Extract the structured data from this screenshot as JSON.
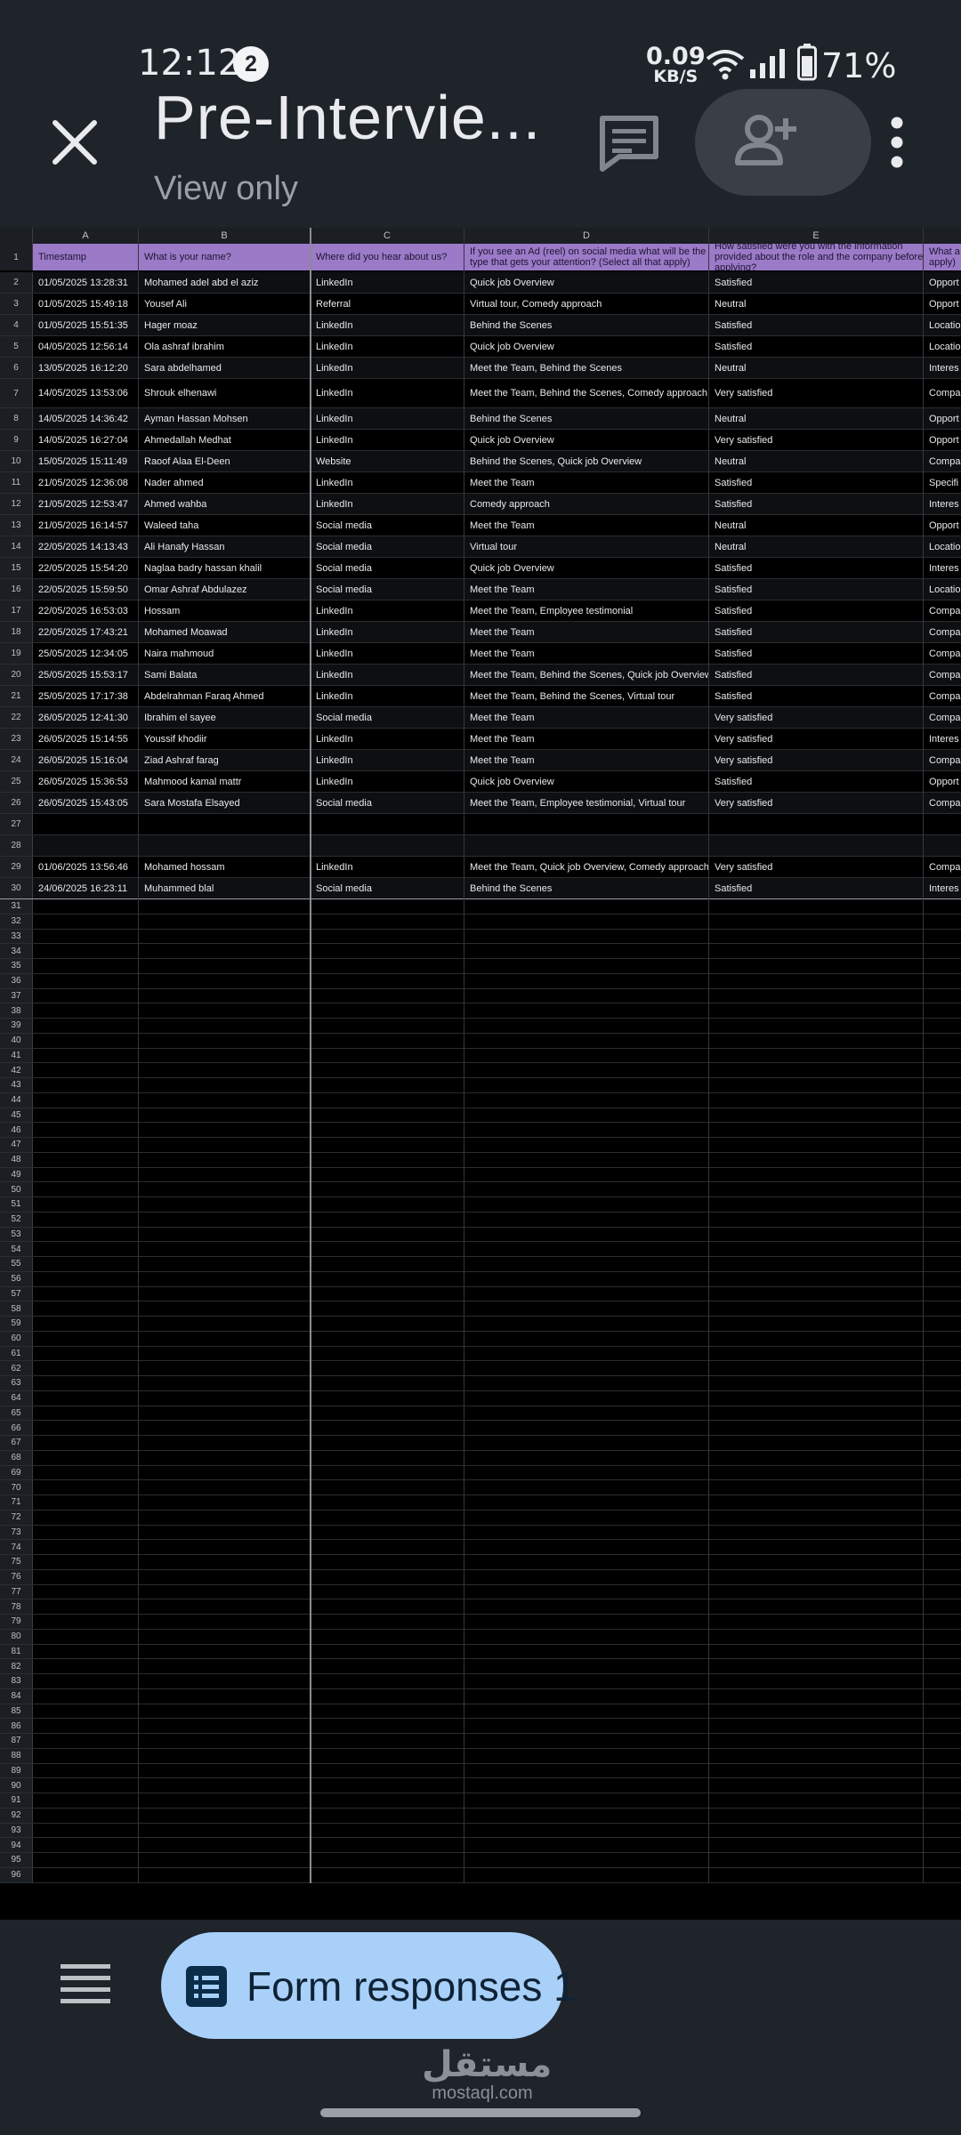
{
  "status_bar": {
    "time": "12:12",
    "notification_count": "2",
    "network_speed": "0.09",
    "network_unit": "KB/S",
    "battery": "71%"
  },
  "header": {
    "title": "Pre-Intervie...",
    "subtitle": "View only"
  },
  "sheet": {
    "column_letters": [
      "A",
      "B",
      "C",
      "D",
      "E",
      ""
    ],
    "headers": [
      "Timestamp",
      "What is your name?",
      "Where did you hear about us?",
      "If you see an Ad (reel) on social media what will be the type that gets your attention? (Select all that apply)",
      "How satisfied were you with the information provided about the role and the company before applying?",
      "What a apply)"
    ],
    "rows": [
      {
        "n": "2",
        "cells": [
          "01/05/2025 13:28:31",
          "Mohamed adel abd el aziz",
          "LinkedIn",
          "Quick job Overview",
          "Satisfied",
          "Opport"
        ]
      },
      {
        "n": "3",
        "cells": [
          "01/05/2025 15:49:18",
          "Yousef Ali",
          "Referral",
          "Virtual tour, Comedy approach",
          "Neutral",
          "Opport"
        ]
      },
      {
        "n": "4",
        "cells": [
          "01/05/2025 15:51:35",
          "Hager moaz",
          "LinkedIn",
          "Behind the Scenes",
          "Satisfied",
          "Locatio"
        ]
      },
      {
        "n": "5",
        "cells": [
          "04/05/2025 12:56:14",
          "Ola ashraf ibrahim",
          "LinkedIn",
          "Quick job Overview",
          "Satisfied",
          "Locatio"
        ]
      },
      {
        "n": "6",
        "cells": [
          "13/05/2025 16:12:20",
          "Sara abdelhamed",
          "LinkedIn",
          "Meet the Team, Behind the Scenes",
          "Neutral",
          "Interes"
        ]
      },
      {
        "n": "7",
        "cells": [
          "14/05/2025 13:53:06",
          "Shrouk elhenawi",
          "LinkedIn",
          "Meet the Team, Behind the Scenes, Comedy approach",
          "Very satisfied",
          "Compa growth Interes"
        ]
      },
      {
        "n": "8",
        "cells": [
          "14/05/2025 14:36:42",
          "Ayman Hassan Mohsen",
          "LinkedIn",
          "Behind the Scenes",
          "Neutral",
          "Opport"
        ]
      },
      {
        "n": "9",
        "cells": [
          "14/05/2025 16:27:04",
          "Ahmedallah Medhat",
          "LinkedIn",
          "Quick job Overview",
          "Very satisfied",
          "Opport"
        ]
      },
      {
        "n": "10",
        "cells": [
          "15/05/2025 15:11:49",
          "Raoof Alaa El-Deen",
          "Website",
          "Behind the Scenes, Quick job Overview",
          "Neutral",
          "Compa"
        ]
      },
      {
        "n": "11",
        "cells": [
          "21/05/2025 12:36:08",
          "Nader ahmed",
          "LinkedIn",
          "Meet the Team",
          "Satisfied",
          "Specifi"
        ]
      },
      {
        "n": "12",
        "cells": [
          "21/05/2025 12:53:47",
          "Ahmed wahba",
          "LinkedIn",
          "Comedy approach",
          "Satisfied",
          "Interes"
        ]
      },
      {
        "n": "13",
        "cells": [
          "21/05/2025 16:14:57",
          "Waleed taha",
          "Social media",
          "Meet the Team",
          "Neutral",
          "Opport"
        ]
      },
      {
        "n": "14",
        "cells": [
          "22/05/2025 14:13:43",
          "Ali Hanafy Hassan",
          "Social media",
          "Virtual tour",
          "Neutral",
          "Locatio"
        ]
      },
      {
        "n": "15",
        "cells": [
          "22/05/2025 15:54:20",
          "Naglaa badry hassan khalil",
          "Social media",
          "Quick job Overview",
          "Satisfied",
          "Interes"
        ]
      },
      {
        "n": "16",
        "cells": [
          "22/05/2025 15:59:50",
          "Omar Ashraf Abdulazez",
          "Social media",
          "Meet the Team",
          "Satisfied",
          "Locatio"
        ]
      },
      {
        "n": "17",
        "cells": [
          "22/05/2025 16:53:03",
          "Hossam",
          "LinkedIn",
          "Meet the Team, Employee testimonial",
          "Satisfied",
          "Compa"
        ]
      },
      {
        "n": "18",
        "cells": [
          "22/05/2025 17:43:21",
          "Mohamed Moawad",
          "LinkedIn",
          "Meet the Team",
          "Satisfied",
          "Compa"
        ]
      },
      {
        "n": "19",
        "cells": [
          "25/05/2025 12:34:05",
          "Naira mahmoud",
          "LinkedIn",
          "Meet the Team",
          "Satisfied",
          "Compa"
        ]
      },
      {
        "n": "20",
        "cells": [
          "25/05/2025 15:53:17",
          "Sami Balata",
          "LinkedIn",
          "Meet the Team, Behind the Scenes, Quick job Overview",
          "Satisfied",
          "Compa"
        ]
      },
      {
        "n": "21",
        "cells": [
          "25/05/2025 17:17:38",
          "Abdelrahman Faraq Ahmed",
          "LinkedIn",
          "Meet the Team, Behind the Scenes, Virtual tour",
          "Satisfied",
          "Compa"
        ]
      },
      {
        "n": "22",
        "cells": [
          "26/05/2025 12:41:30",
          "Ibrahim el sayee",
          "Social media",
          "Meet the Team",
          "Very satisfied",
          "Compa"
        ]
      },
      {
        "n": "23",
        "cells": [
          "26/05/2025 15:14:55",
          "Youssif khodiir",
          "LinkedIn",
          "Meet the Team",
          "Very satisfied",
          "Interes"
        ]
      },
      {
        "n": "24",
        "cells": [
          "26/05/2025 15:16:04",
          "Ziad Ashraf farag",
          "LinkedIn",
          "Meet the Team",
          "Very satisfied",
          "Compa"
        ]
      },
      {
        "n": "25",
        "cells": [
          "26/05/2025 15:36:53",
          "Mahmood kamal mattr",
          "LinkedIn",
          "Quick job Overview",
          "Satisfied",
          "Opport"
        ]
      },
      {
        "n": "26",
        "cells": [
          "26/05/2025 15:43:05",
          "Sara Mostafa Elsayed",
          "Social media",
          "Meet the Team, Employee testimonial, Virtual tour",
          "Very satisfied",
          "Compa"
        ]
      },
      {
        "n": "27",
        "cells": [
          "",
          "",
          "",
          "",
          "",
          ""
        ]
      },
      {
        "n": "28",
        "cells": [
          "",
          "",
          "",
          "",
          "",
          ""
        ]
      },
      {
        "n": "29",
        "cells": [
          "01/06/2025 13:56:46",
          "Mohamed hossam",
          "LinkedIn",
          "Meet the Team, Quick job Overview, Comedy approach",
          "Very satisfied",
          "Compa"
        ]
      },
      {
        "n": "30",
        "cells": [
          "24/06/2025 16:23:11",
          "Muhammed blal",
          "Social media",
          "Behind the Scenes",
          "Satisfied",
          "Interes"
        ]
      }
    ],
    "empty_row_start": 31,
    "empty_row_end": 96
  },
  "bottom": {
    "sheet_tab_label": "Form responses 1",
    "watermark_arabic": "مستقل",
    "watermark_latin": "mostaql.com"
  }
}
